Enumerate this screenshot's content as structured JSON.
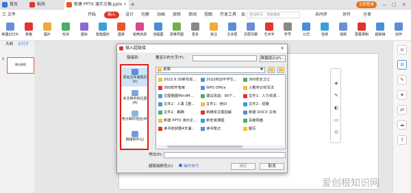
{
  "colors": {
    "accent": "#e2342a",
    "link_red": "#e11a1a",
    "login": "#e2771a",
    "ppt_orange": "#e8562a"
  },
  "tabs": [
    {
      "label": "首页",
      "icon": "home-icon"
    },
    {
      "label": "稻壳",
      "icon": "docer-icon"
    },
    {
      "label": "新建 PPTX 演示文稿.pptx",
      "icon": "ppt-file-icon"
    }
  ],
  "login_label": "立即登录",
  "menu": {
    "file": "三 文件",
    "items": [
      "开始",
      "插入",
      "设计",
      "切换",
      "动画",
      "放映",
      "审阅",
      "视图",
      "开发工具",
      "会"
    ],
    "search": "查找命令、搜索模板",
    "right": [
      "未同步",
      "协作",
      "分享"
    ]
  },
  "ribbon": [
    "新建幻灯片",
    "表格",
    "图片",
    "形状",
    "图标",
    "智能图形",
    "图表",
    "稻壳资源",
    "流程图",
    "思维导图",
    "更多",
    "批注",
    "文本框",
    "页眉页脚",
    "艺术字",
    "符号",
    "公式",
    "音频",
    "视频",
    "屏幕录制",
    "超链接",
    "动作"
  ],
  "ribbon_small": [
    "日期和时间",
    "幻灯片编号",
    "附件",
    "对象"
  ],
  "left_panel": {
    "tabs": [
      "大纲",
      "幻灯片"
    ],
    "slide_number": "1",
    "slide_title": "做出课程"
  },
  "dialog": {
    "title": "插入超链接",
    "link_to": "链接到:",
    "display_text_label": "要显示的文字(T):",
    "display_text_value": "",
    "screen_tip": "屏幕提示(P)...",
    "link_options": [
      "原有文件或网页(X)",
      "本文档中的位置(A)",
      "电子邮件地址(M)",
      "链接附件(L)"
    ],
    "path": "桌面",
    "files": [
      [
        "2022.9.30新花名...",
        "2022秋创平学生...",
        "360安全卫士"
      ],
      [
        "360软件管家",
        "WPS Office",
        "人教传记初写法"
      ],
      [
        "亿图脑图MindM...",
        "建议改造：90个...",
        "文件1：人力资源..."
      ],
      [
        "文件2：人事【重...",
        "文件1：培训",
        "文件2：招聘"
      ],
      [
        "文件2：薪酬",
        "新媒体文案拍解",
        "新建 DOCX 文档"
      ],
      [
        "新建 PPTX 演示文...",
        "新安装课图",
        "百度网盘"
      ],
      [
        "读书收获整4天诵...",
        "读书笔记",
        "脑写"
      ]
    ],
    "address_label": "地址(E):",
    "address_value": "",
    "color_label": "超链接颜色(C)",
    "tips": "操作技巧",
    "ok": "确定",
    "cancel": "取消"
  },
  "watermark": "爱创根知识网"
}
